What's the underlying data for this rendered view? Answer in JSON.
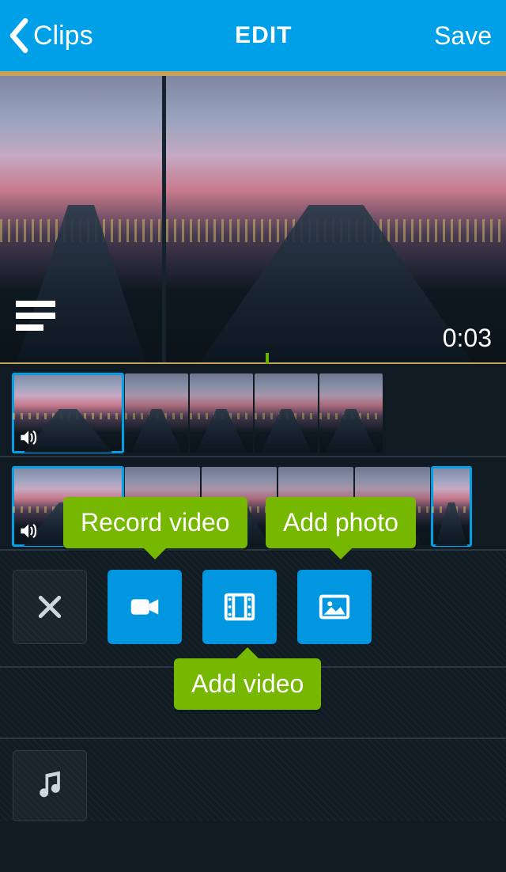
{
  "header": {
    "back_label": "Clips",
    "title": "EDIT",
    "action_label": "Save"
  },
  "preview": {
    "timecode": "0:03"
  },
  "tooltips": {
    "record": "Record video",
    "add_photo": "Add photo",
    "add_video": "Add video"
  },
  "icons": {
    "chevron_left": "chevron-left-icon",
    "list": "list-icon",
    "sound": "sound-icon",
    "close": "close-icon",
    "camera_video": "video-camera-icon",
    "film": "film-icon",
    "image": "image-icon",
    "music": "music-note-icon"
  },
  "colors": {
    "accent": "#00a0e9",
    "tooltip": "#76b800"
  }
}
